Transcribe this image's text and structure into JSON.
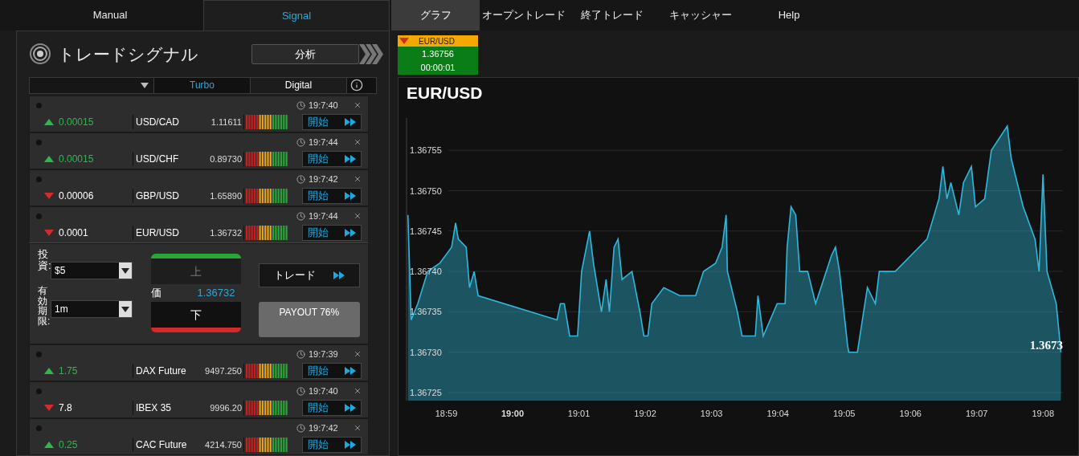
{
  "left_tabs": [
    {
      "label": "Manual",
      "selected": false
    },
    {
      "label": "Signal",
      "selected": true
    }
  ],
  "right_tabs": [
    {
      "label": "グラフ",
      "selected": true
    },
    {
      "label": "オープントレード",
      "selected": false
    },
    {
      "label": "終了トレード",
      "selected": false
    },
    {
      "label": "キャッシャー",
      "selected": false
    },
    {
      "label": "Help",
      "selected": false
    }
  ],
  "signal_panel": {
    "title": "トレードシグナル",
    "analysis_button": "分析",
    "filter_tabs": [
      {
        "label": "Turbo",
        "selected": true
      },
      {
        "label": "Digital",
        "selected": false
      }
    ],
    "signals": [
      {
        "rising": true,
        "change": "0.00015",
        "symbol": "USD/CAD",
        "price": "1.11611",
        "time": "19:7:40",
        "action": "開始",
        "expanded": false
      },
      {
        "rising": true,
        "change": "0.00015",
        "symbol": "USD/CHF",
        "price": "0.89730",
        "time": "19:7:44",
        "action": "開始",
        "expanded": false
      },
      {
        "rising": false,
        "change": "0.00006",
        "symbol": "GBP/USD",
        "price": "1.65890",
        "time": "19:7:42",
        "action": "開始",
        "expanded": false
      },
      {
        "rising": false,
        "change": "0.0001",
        "symbol": "EUR/USD",
        "price": "1.36732",
        "time": "19:7:44",
        "action": "開始",
        "expanded": true
      },
      {
        "rising": true,
        "change": "1.75",
        "symbol": "DAX Future",
        "price": "9497.250",
        "time": "19:7:39",
        "action": "開始",
        "expanded": false
      },
      {
        "rising": false,
        "change": "7.8",
        "symbol": "IBEX 35",
        "price": "9996.20",
        "time": "19:7:40",
        "action": "開始",
        "expanded": false
      },
      {
        "rising": true,
        "change": "0.25",
        "symbol": "CAC Future",
        "price": "4214.750",
        "time": "19:7:42",
        "action": "開始",
        "expanded": false
      }
    ],
    "trade_form": {
      "investment": {
        "label": "投資:",
        "value": "$5"
      },
      "expiry": {
        "label": "有効期限:",
        "value": "1m"
      },
      "up_button": {
        "label": "上",
        "disabled": true
      },
      "down_button": {
        "label": "下",
        "disabled": false
      },
      "price_label": "価",
      "price": "1.36732",
      "trade_button": "トレード",
      "payout": "PAYOUT 76%"
    }
  },
  "ticker": {
    "symbol": "EUR/USD",
    "rising": false,
    "price": "1.36756",
    "countdown": "00:00:01"
  },
  "chart": {
    "chart_data": {
      "type": "area",
      "title": "EUR/USD",
      "grid": true,
      "xlim": [
        1138.4,
        1148.3
      ],
      "ylim": [
        1.36724,
        1.36759
      ],
      "xticks": [
        {
          "value": 1139,
          "label": "18:59"
        },
        {
          "value": 1140,
          "label": "19:00"
        },
        {
          "value": 1141,
          "label": "19:01"
        },
        {
          "value": 1142,
          "label": "19:02"
        },
        {
          "value": 1143,
          "label": "19:03"
        },
        {
          "value": 1144,
          "label": "19:04"
        },
        {
          "value": 1145,
          "label": "19:05"
        },
        {
          "value": 1146,
          "label": "19:06"
        },
        {
          "value": 1147,
          "label": "19:07"
        },
        {
          "value": 1148,
          "label": "19:08"
        }
      ],
      "yticks": [
        {
          "value": 1.36725,
          "label": "1.36725"
        },
        {
          "value": 1.3673,
          "label": "1.36730"
        },
        {
          "value": 1.36735,
          "label": "1.36735"
        },
        {
          "value": 1.3674,
          "label": "1.36740"
        },
        {
          "value": 1.36745,
          "label": "1.36745"
        },
        {
          "value": 1.3675,
          "label": "1.36750"
        },
        {
          "value": 1.36755,
          "label": "1.36755"
        }
      ],
      "x": [
        1138.42,
        1138.47,
        1138.57,
        1138.72,
        1138.9,
        1139.08,
        1139.14,
        1139.18,
        1139.3,
        1139.35,
        1139.42,
        1139.48,
        1140.67,
        1140.72,
        1140.78,
        1140.86,
        1140.98,
        1141.04,
        1141.16,
        1141.22,
        1141.34,
        1141.41,
        1141.46,
        1141.53,
        1141.59,
        1141.65,
        1141.8,
        1141.92,
        1141.98,
        1142.04,
        1142.1,
        1142.28,
        1142.52,
        1142.76,
        1142.88,
        1143.06,
        1143.16,
        1143.22,
        1143.24,
        1143.39,
        1143.46,
        1143.66,
        1143.7,
        1143.78,
        1143.99,
        1144.11,
        1144.14,
        1144.2,
        1144.27,
        1144.33,
        1144.45,
        1144.57,
        1144.81,
        1144.87,
        1144.93,
        1145.05,
        1145.07,
        1145.2,
        1145.35,
        1145.47,
        1145.53,
        1145.77,
        1146.01,
        1146.25,
        1146.43,
        1146.49,
        1146.55,
        1146.61,
        1146.73,
        1146.8,
        1146.92,
        1146.98,
        1147.12,
        1147.22,
        1147.46,
        1147.52,
        1147.7,
        1147.88,
        1147.94,
        1148,
        1148.06,
        1148.2,
        1148.27
      ],
      "series": [
        {
          "color": "#2fb8dc",
          "values": [
            1.36747,
            1.36734,
            1.36736,
            1.3674,
            1.36741,
            1.36743,
            1.36746,
            1.36744,
            1.36743,
            1.36738,
            1.3674,
            1.36737,
            1.36734,
            1.36736,
            1.36736,
            1.36732,
            1.36732,
            1.3674,
            1.36745,
            1.36741,
            1.36735,
            1.36739,
            1.36735,
            1.36743,
            1.36744,
            1.36739,
            1.3674,
            1.36735,
            1.36732,
            1.36732,
            1.36736,
            1.36738,
            1.36737,
            1.36737,
            1.3674,
            1.36741,
            1.36743,
            1.36747,
            1.3674,
            1.36735,
            1.36732,
            1.36732,
            1.36737,
            1.36732,
            1.36736,
            1.36736,
            1.36743,
            1.36748,
            1.36747,
            1.3674,
            1.3674,
            1.36736,
            1.36742,
            1.36743,
            1.3674,
            1.36731,
            1.3673,
            1.3673,
            1.36738,
            1.36736,
            1.3674,
            1.3674,
            1.36742,
            1.36744,
            1.36749,
            1.36753,
            1.36749,
            1.36751,
            1.36747,
            1.36751,
            1.36753,
            1.36748,
            1.36749,
            1.36755,
            1.36758,
            1.36754,
            1.36748,
            1.36744,
            1.3674,
            1.36752,
            1.3674,
            1.36736,
            1.3673
          ]
        }
      ],
      "annotations": [
        "1.3673"
      ]
    }
  }
}
